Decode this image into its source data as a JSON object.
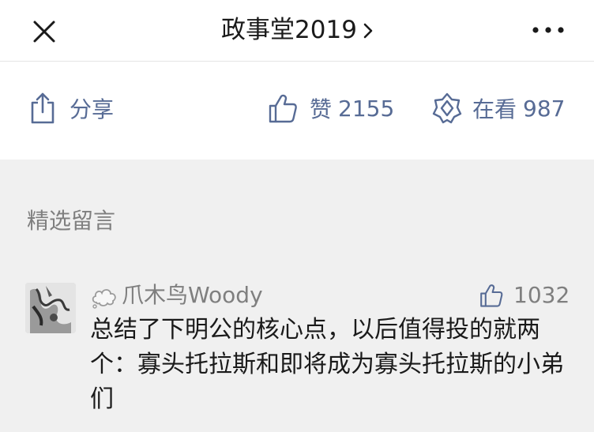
{
  "nav": {
    "title": "政事堂2019",
    "close_icon": "close-icon",
    "more_icon": "more-icon"
  },
  "actions": {
    "share_label": "分享",
    "like_label": "赞",
    "like_count": "2155",
    "wow_label": "在看",
    "wow_count": "987",
    "accent_color": "#576b95"
  },
  "comments_section": {
    "title": "精选留言",
    "items": [
      {
        "nickname": "爪木鸟Woody",
        "like_count": "1032",
        "text": "总结了下明公的核心点，以后值得投的就两个：寡头托拉斯和即将成为寡头托拉斯的小弟们"
      }
    ]
  }
}
